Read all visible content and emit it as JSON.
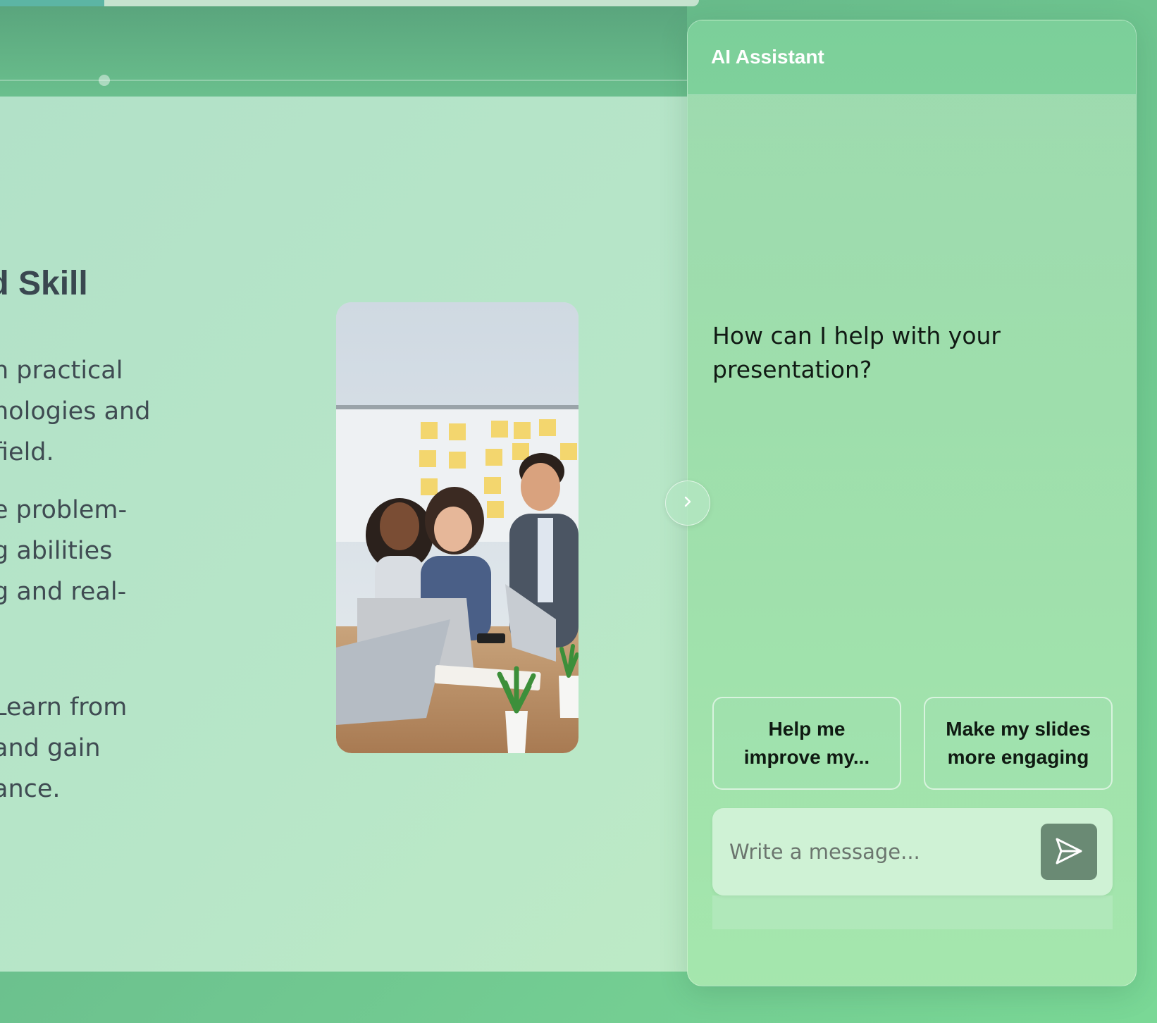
{
  "slide": {
    "title": "nd Skill",
    "paragraphs": [
      [
        "n practical",
        "nologies and",
        " field."
      ],
      [
        "e problem-",
        "g abilities",
        "g and real-"
      ],
      [
        " Learn from",
        " and gain",
        "ance."
      ]
    ]
  },
  "assistant": {
    "title": "AI Assistant",
    "prompt": "How can I help with your presentation?",
    "suggestions": [
      "Help me improve my...",
      "Make my slides more engaging"
    ],
    "input_placeholder": "Write a message..."
  },
  "icons": {
    "collapse": "chevron-right-icon",
    "send": "send-icon"
  },
  "colors": {
    "background": "#6cc18e",
    "slide": "#b7e6c8",
    "panel": "#8fdc9f",
    "send_button": "#6a8a74",
    "title_text": "#3a4750"
  }
}
